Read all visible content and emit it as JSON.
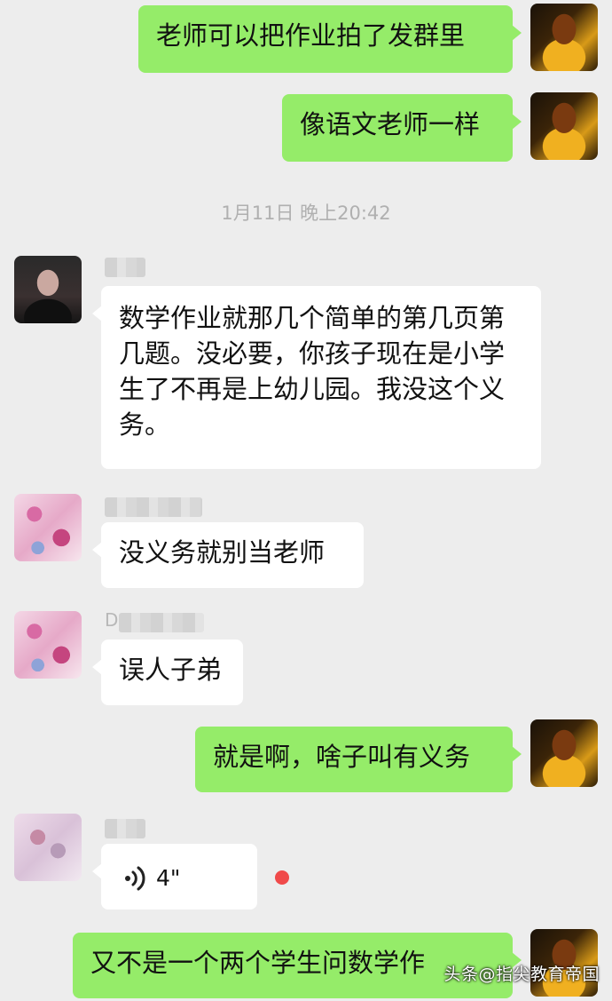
{
  "messages": {
    "m1": "老师可以把作业拍了发群里",
    "m2": "像语文老师一样",
    "m3": "数学作业就那几个简单的第几页第几题。没必要，你孩子现在是小学生了不再是上幼儿园。我没这个义务。",
    "m4": "没义务就别当老师",
    "m5": "误人子弟",
    "m6": "就是啊，啥子叫有义务",
    "m8": "又不是一个两个学生问数学作"
  },
  "timestamp": "1月11日 晚上20:42",
  "voice": {
    "duration": "4\""
  },
  "senders": {
    "s5_prefix": "D"
  },
  "watermark": "头条@指尖教育帝国",
  "colors": {
    "green_bubble": "#95ec69",
    "white_bubble": "#ffffff",
    "background": "#ededed",
    "unread": "#f04a4a"
  }
}
